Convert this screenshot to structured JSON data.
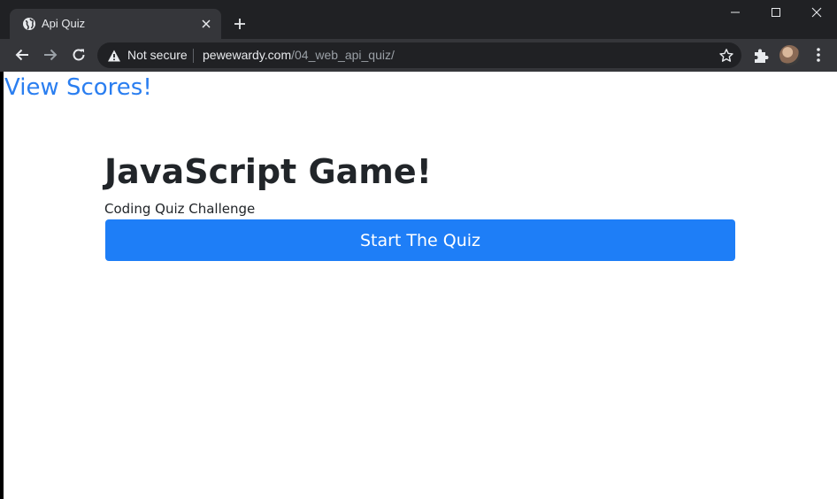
{
  "browser": {
    "tab": {
      "title": "Api Quiz",
      "favicon": "globe-icon"
    },
    "new_tab_icon": "plus-icon",
    "window_controls": [
      "minimize-icon",
      "maximize-icon",
      "close-icon"
    ],
    "toolbar": {
      "security_label": "Not secure",
      "url_host": "pewewardy.com",
      "url_path": "/04_web_api_quiz/"
    }
  },
  "page": {
    "view_scores_link": "View Scores!",
    "heading": "JavaScript Game!",
    "subtitle": "Coding Quiz Challenge",
    "start_button": "Start The Quiz"
  },
  "colors": {
    "link": "#2a7ef0",
    "primary_button": "#1e7ef7",
    "heading_text": "#212529",
    "browser_frame": "#202124",
    "toolbar": "#35363a"
  }
}
